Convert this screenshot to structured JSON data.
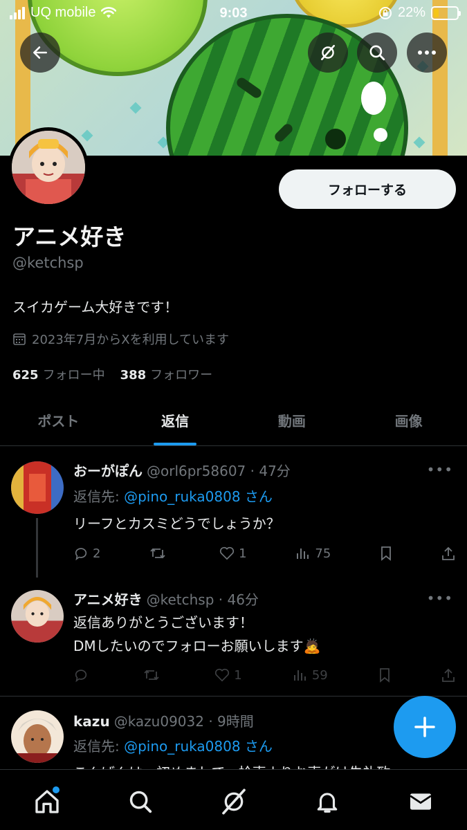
{
  "status_bar": {
    "carrier": "UQ mobile",
    "time": "9:03",
    "battery": "22%",
    "battery_level": 0.22
  },
  "banner": {
    "description_icons": [
      "back-icon",
      "grok-icon",
      "search-icon",
      "more-icon"
    ]
  },
  "profile": {
    "display_name": "アニメ好き",
    "handle": "@ketchsp",
    "follow_label": "フォローする",
    "bio": "スイカゲーム大好きです！",
    "joined": "2023年7月からXを利用しています",
    "following_count": "625",
    "following_label": "フォロー中",
    "followers_count": "388",
    "followers_label": "フォロワー"
  },
  "tabs": [
    {
      "label": "ポスト",
      "active": false
    },
    {
      "label": "返信",
      "active": true
    },
    {
      "label": "動画",
      "active": false
    },
    {
      "label": "画像",
      "active": false
    }
  ],
  "posts": [
    {
      "display_name": "おーがぽん",
      "meta": "@orl6pr58607 · 47分",
      "reply_prefix": "返信先: ",
      "reply_to": "@pino_ruka0808 さん",
      "text": "リーフとカスミどうでしょうか？",
      "replies": "2",
      "reposts": "",
      "likes": "1",
      "views": "75"
    },
    {
      "display_name": "アニメ好き",
      "meta": "@ketchsp · 46分",
      "text_line1": "返信ありがとうございます！",
      "text_line2": "DMしたいのでフォローお願いします🙇",
      "replies": "",
      "reposts": "",
      "likes": "1",
      "views": "59"
    },
    {
      "display_name": "kazu",
      "meta": "@kazu09032 · 9時間",
      "reply_prefix": "返信先: ",
      "reply_to": "@pino_ruka0808 さん",
      "text_partial": "こんばんは。初めまして。拾声よりお声がけ失礼致"
    }
  ],
  "colors": {
    "accent": "#1d9bf0",
    "background": "#000000",
    "muted": "#71767b"
  }
}
